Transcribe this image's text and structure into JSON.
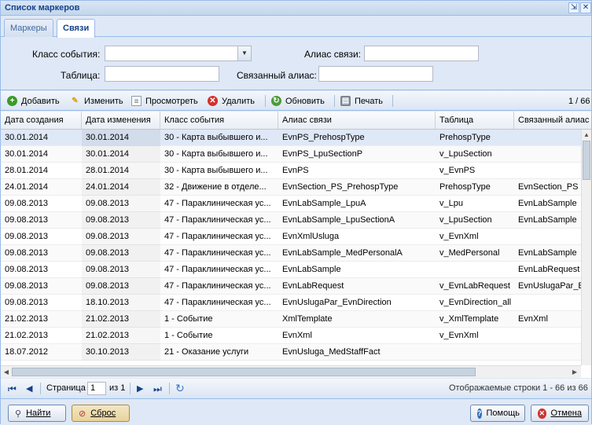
{
  "window": {
    "title": "Список маркеров"
  },
  "tabs": [
    {
      "label": "Маркеры"
    },
    {
      "label": "Связи"
    }
  ],
  "filters": {
    "event_class_label": "Класс события:",
    "link_alias_label": "Алиас связи:",
    "table_label": "Таблица:",
    "linked_alias_label": "Связанный алиас:",
    "event_class_value": "",
    "link_alias_value": "",
    "table_value": "",
    "linked_alias_value": ""
  },
  "toolbar": {
    "add": "Добавить",
    "edit": "Изменить",
    "view": "Просмотреть",
    "delete": "Удалить",
    "refresh": "Обновить",
    "print": "Печать",
    "count": "1 / 66"
  },
  "grid": {
    "columns": [
      "Дата создания",
      "Дата изменения",
      "Класс события",
      "Алиас связи",
      "Таблица",
      "Связанный алиас"
    ],
    "rows": [
      [
        "30.01.2014",
        "30.01.2014",
        "30 - Карта выбывшего и...",
        "EvnPS_PrehospType",
        "PrehospType",
        ""
      ],
      [
        "30.01.2014",
        "30.01.2014",
        "30 - Карта выбывшего и...",
        "EvnPS_LpuSectionP",
        "v_LpuSection",
        ""
      ],
      [
        "28.01.2014",
        "28.01.2014",
        "30 - Карта выбывшего и...",
        "EvnPS",
        "v_EvnPS",
        ""
      ],
      [
        "24.01.2014",
        "24.01.2014",
        "32 - Движение в отделе...",
        "EvnSection_PS_PrehospType",
        "PrehospType",
        "EvnSection_PS"
      ],
      [
        "09.08.2013",
        "09.08.2013",
        "47 - Параклиническая ус...",
        "EvnLabSample_LpuA",
        "v_Lpu",
        "EvnLabSample"
      ],
      [
        "09.08.2013",
        "09.08.2013",
        "47 - Параклиническая ус...",
        "EvnLabSample_LpuSectionA",
        "v_LpuSection",
        "EvnLabSample"
      ],
      [
        "09.08.2013",
        "09.08.2013",
        "47 - Параклиническая ус...",
        "EvnXmlUsluga",
        "v_EvnXml",
        ""
      ],
      [
        "09.08.2013",
        "09.08.2013",
        "47 - Параклиническая ус...",
        "EvnLabSample_MedPersonalA",
        "v_MedPersonal",
        "EvnLabSample"
      ],
      [
        "09.08.2013",
        "09.08.2013",
        "47 - Параклиническая ус...",
        "EvnLabSample",
        "",
        "EvnLabRequest"
      ],
      [
        "09.08.2013",
        "09.08.2013",
        "47 - Параклиническая ус...",
        "EvnLabRequest",
        "v_EvnLabRequest",
        "EvnUslugaPar_E"
      ],
      [
        "09.08.2013",
        "18.10.2013",
        "47 - Параклиническая ус...",
        "EvnUslugaPar_EvnDirection",
        "v_EvnDirection_all",
        ""
      ],
      [
        "21.02.2013",
        "21.02.2013",
        "1 - Событие",
        "XmlTemplate",
        "v_XmlTemplate",
        "EvnXml"
      ],
      [
        "21.02.2013",
        "21.02.2013",
        "1 - Событие",
        "EvnXml",
        "v_EvnXml",
        ""
      ],
      [
        "18.07.2012",
        "30.10.2013",
        "21 - Оказание услуги",
        "EvnUsluga_MedStaffFact",
        "",
        ""
      ]
    ]
  },
  "pager": {
    "page_label": "Страница",
    "page_value": "1",
    "of_label": "из 1",
    "status": "Отображаемые строки 1 - 66 из 66"
  },
  "footer": {
    "find": "Найти",
    "reset": "Сброс",
    "help": "Помощь",
    "cancel": "Отмена"
  },
  "colors": {
    "header_text": "#15428b",
    "panel_bg": "#dfe8f6",
    "border": "#99bbe8"
  }
}
